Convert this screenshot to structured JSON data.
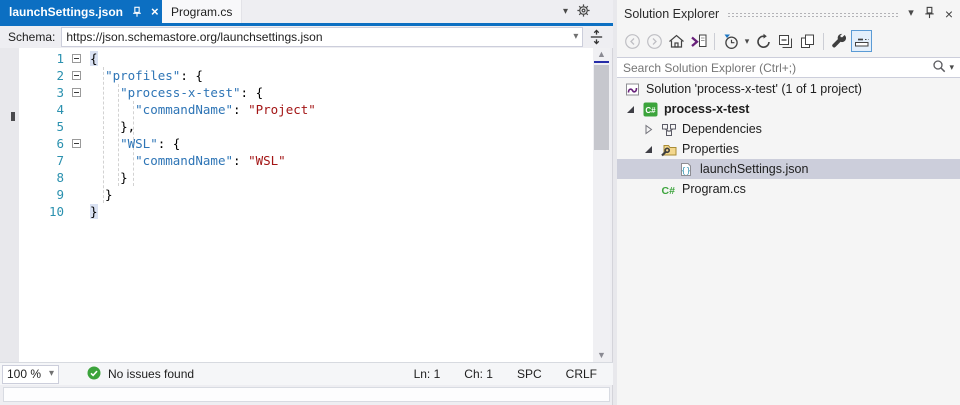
{
  "tabs": {
    "active": {
      "label": "launchSettings.json"
    },
    "inactive": {
      "label": "Program.cs"
    }
  },
  "schema_bar": {
    "label": "Schema:",
    "value": "https://json.schemastore.org/launchsettings.json"
  },
  "editor": {
    "lines": [
      {
        "n": "1",
        "fold": true,
        "tokens": [
          {
            "c": "hl",
            "v": "{"
          }
        ]
      },
      {
        "n": "2",
        "fold": true,
        "tokens": [
          {
            "c": "p",
            "v": "  "
          },
          {
            "c": "k",
            "v": "\"profiles\""
          },
          {
            "c": "p",
            "v": ": {"
          }
        ]
      },
      {
        "n": "3",
        "fold": true,
        "tokens": [
          {
            "c": "p",
            "v": "    "
          },
          {
            "c": "k",
            "v": "\"process-x-test\""
          },
          {
            "c": "p",
            "v": ": {"
          }
        ]
      },
      {
        "n": "4",
        "fold": false,
        "tokens": [
          {
            "c": "p",
            "v": "      "
          },
          {
            "c": "k",
            "v": "\"commandName\""
          },
          {
            "c": "p",
            "v": ": "
          },
          {
            "c": "s",
            "v": "\"Project\""
          }
        ]
      },
      {
        "n": "5",
        "fold": false,
        "tokens": [
          {
            "c": "p",
            "v": "    },"
          }
        ]
      },
      {
        "n": "6",
        "fold": true,
        "tokens": [
          {
            "c": "p",
            "v": "    "
          },
          {
            "c": "k",
            "v": "\"WSL\""
          },
          {
            "c": "p",
            "v": ": {"
          }
        ]
      },
      {
        "n": "7",
        "fold": false,
        "tokens": [
          {
            "c": "p",
            "v": "      "
          },
          {
            "c": "k",
            "v": "\"commandName\""
          },
          {
            "c": "p",
            "v": ": "
          },
          {
            "c": "s",
            "v": "\"WSL\""
          }
        ]
      },
      {
        "n": "8",
        "fold": false,
        "tokens": [
          {
            "c": "p",
            "v": "    }"
          }
        ]
      },
      {
        "n": "9",
        "fold": false,
        "tokens": [
          {
            "c": "p",
            "v": "  }"
          }
        ]
      },
      {
        "n": "10",
        "fold": false,
        "tokens": [
          {
            "c": "hl",
            "v": "}"
          }
        ]
      }
    ]
  },
  "status": {
    "zoom_level": "100 %",
    "message": "No issues found",
    "ln": "Ln: 1",
    "ch": "Ch: 1",
    "spc": "SPC",
    "eol": "CRLF"
  },
  "solution_explorer": {
    "title": "Solution Explorer",
    "search_placeholder": "Search Solution Explorer (Ctrl+;)",
    "toolbar_icons": [
      "back",
      "forward",
      "home",
      "sync-with-active-document",
      "pending-changes-filter",
      "refresh",
      "collapse-all",
      "show-all-files",
      "properties",
      "preview-selected-items"
    ],
    "tree": [
      {
        "label": "Solution 'process-x-test' (1 of 1 project)",
        "icon": "solution",
        "indent": 0,
        "expander": "hidden",
        "selected": false,
        "bold": false
      },
      {
        "label": "process-x-test",
        "icon": "csproj",
        "indent": 0,
        "expander": "expanded",
        "selected": false,
        "bold": true
      },
      {
        "label": "Dependencies",
        "icon": "dependencies",
        "indent": 1,
        "expander": "collapsed",
        "selected": false,
        "bold": false
      },
      {
        "label": "Properties",
        "icon": "properties",
        "indent": 1,
        "expander": "expanded",
        "selected": false,
        "bold": false
      },
      {
        "label": "launchSettings.json",
        "icon": "json",
        "indent": 2,
        "expander": "none",
        "selected": true,
        "bold": false
      },
      {
        "label": "Program.cs",
        "icon": "csfile",
        "indent": 1,
        "expander": "none",
        "selected": false,
        "bold": false
      }
    ]
  },
  "colors": {
    "accent_blue": "#0C6FC2",
    "selection_gray": "#CCCEDB",
    "status_green": "#3BA33B",
    "json_key": "#2E75B6",
    "json_string": "#A31515",
    "line_number": "#2B91AF"
  }
}
